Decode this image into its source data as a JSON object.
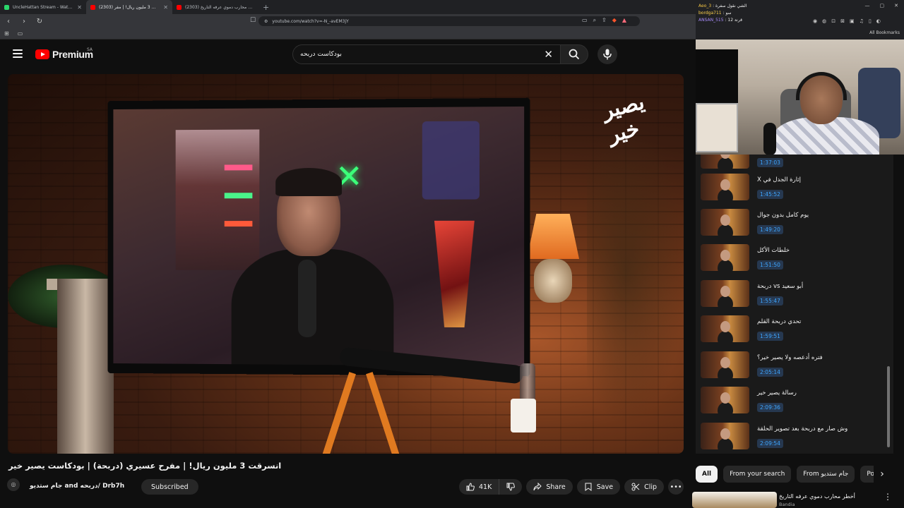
{
  "browser": {
    "tabs": [
      {
        "title": "UncleHattan Stream - Watch Live on",
        "favicon_color": "#2bd66b",
        "active": false
      },
      {
        "title": "(2303) انسرقت 3 مليون ريال! | مفر",
        "favicon_color": "#ff0000",
        "active": true
      },
      {
        "title": "(2303) أخطر محارب دموي عرفه التاريخ",
        "favicon_color": "#ff0000",
        "active": false
      }
    ],
    "new_tab": "+",
    "url": "youtube.com/watch?v=-N_-avEM3jY"
  },
  "header": {
    "brand": "Premium",
    "region": "SA",
    "search_query": "بودكاست دربحه"
  },
  "video": {
    "watermark": "يصير خير"
  },
  "meta": {
    "title": "انسرقت 3 مليون ريال! | مفرح عسيري (دربحة) | بودكاست يصير خير",
    "channel": "جام ستديو and دربحه/ Drb7h",
    "subscribe_label": "Subscribed",
    "likes": "41K",
    "share": "Share",
    "save": "Save",
    "clip": "Clip"
  },
  "stream_overlay": {
    "chat": [
      {
        "user": "Aeo_3",
        "msg": "الشي نقول سفرة"
      },
      {
        "user": "bordga711",
        "msg": "سو"
      },
      {
        "user": "ANSAN_515",
        "msg": "12 قرنة"
      }
    ],
    "all_bookmarks": "All Bookmarks"
  },
  "chapters": [
    {
      "title": "",
      "time": "1:37:03"
    },
    {
      "title": "X إثارة الجدل في",
      "time": "1:45:52"
    },
    {
      "title": "يوم كامل بدون جوال",
      "time": "1:49:20"
    },
    {
      "title": "خلطات الأكل",
      "time": "1:51:50"
    },
    {
      "title": "أبو سعيد vs دربحة",
      "time": "1:55:47"
    },
    {
      "title": "تحدي دربحة القلم",
      "time": "1:59:51"
    },
    {
      "title": "فتره أدعصه ولا يصير خير؟",
      "time": "2:05:14"
    },
    {
      "title": "رسالة يصير خير",
      "time": "2:09:36"
    },
    {
      "title": "وش صار مع دربحة بعد تصوير الحلقة",
      "time": "2:09:54"
    }
  ],
  "chips": [
    "All",
    "From your search",
    "From جام ستديو",
    "Podc"
  ],
  "recommended": {
    "title": "أخطر محارب دموي عرفه التاريخ",
    "channel": "Bandia"
  }
}
